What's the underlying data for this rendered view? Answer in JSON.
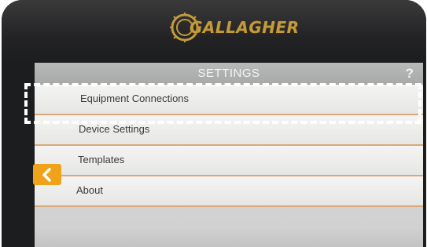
{
  "brand": {
    "name": "GALLAGHER",
    "logo_icon": "gallagher-logo-icon",
    "color": "#c49a3b"
  },
  "screen": {
    "title": "SETTINGS",
    "help_label": "?"
  },
  "menu": {
    "items": [
      {
        "label": "Equipment Connections"
      },
      {
        "label": "Device Settings"
      },
      {
        "label": "Templates"
      },
      {
        "label": "About"
      }
    ]
  },
  "back_button": {
    "icon": "chevron-left-icon",
    "color": "#f0a21a"
  },
  "highlight": {
    "target": "Equipment Connections",
    "style": "white dashed outline"
  }
}
